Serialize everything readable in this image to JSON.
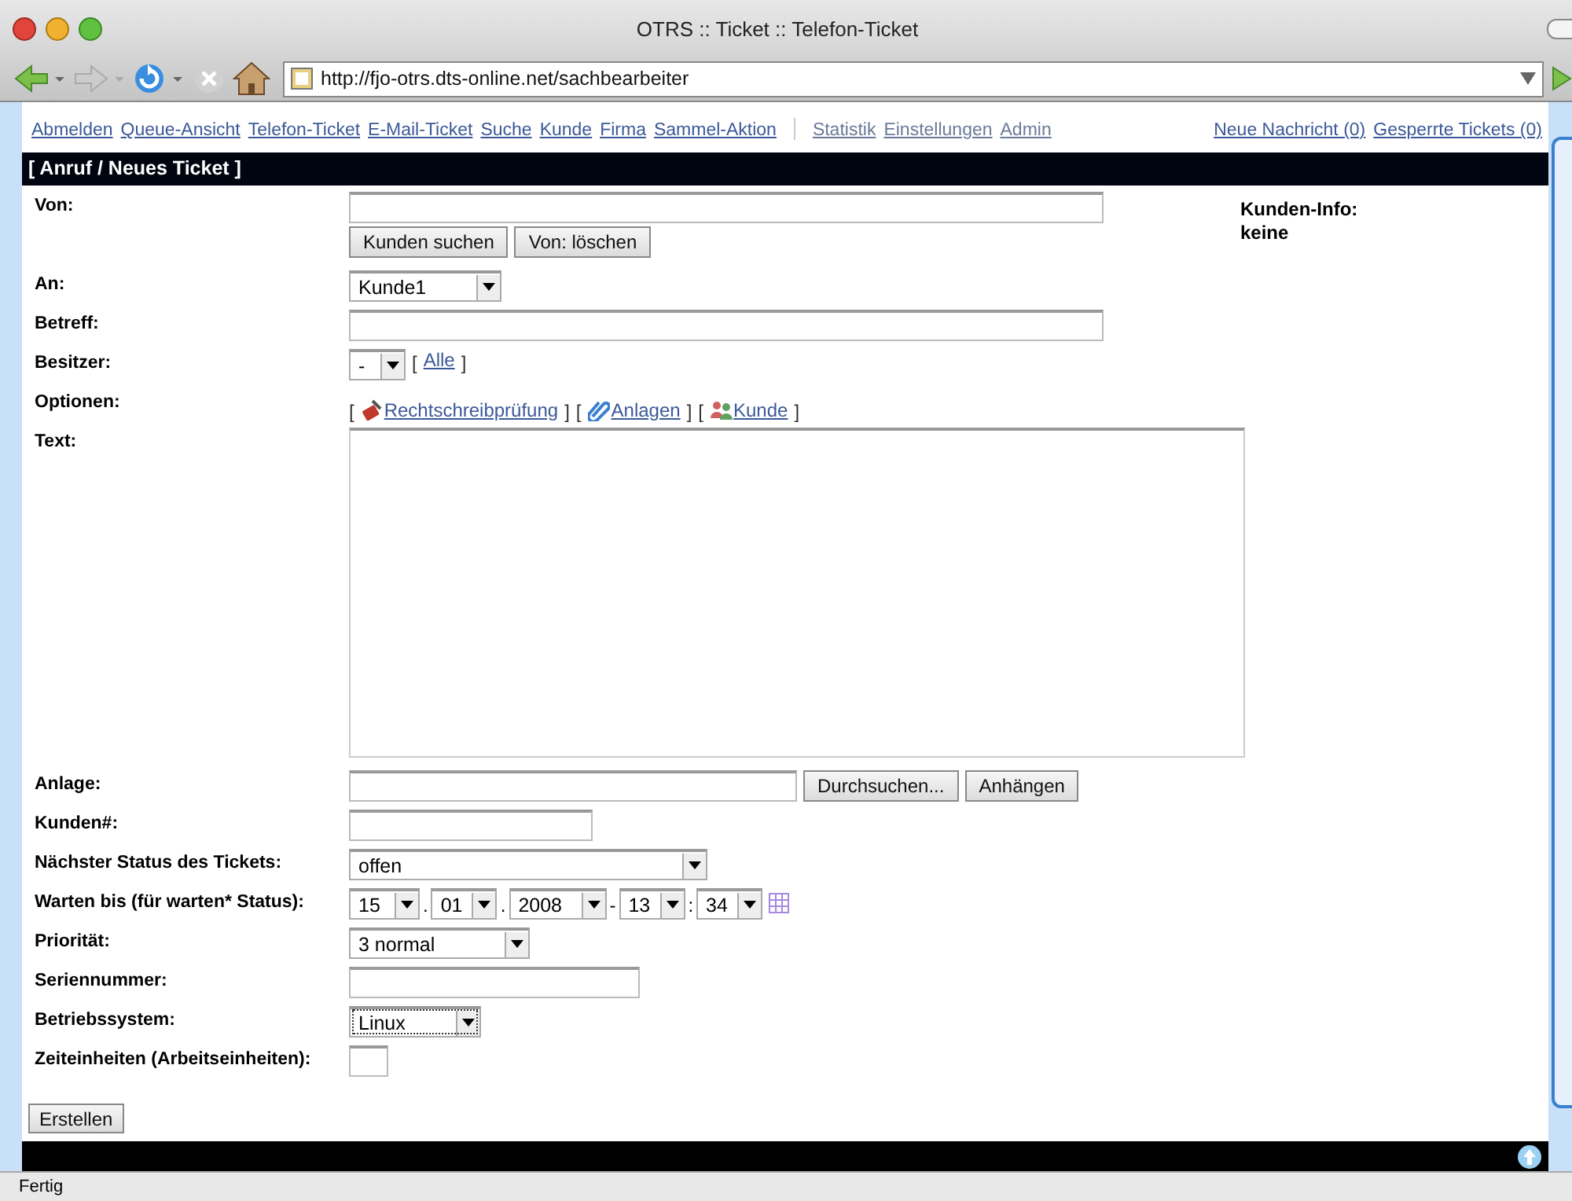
{
  "window": {
    "title": "OTRS :: Ticket :: Telefon-Ticket"
  },
  "toolbar": {
    "url": "http://fjo-otrs.dts-online.net/sachbearbeiter"
  },
  "nav": {
    "links": [
      {
        "label": "Abmelden",
        "kind": "main"
      },
      {
        "label": "Queue-Ansicht",
        "kind": "main"
      },
      {
        "label": "Telefon-Ticket",
        "kind": "main"
      },
      {
        "label": "E-Mail-Ticket",
        "kind": "main"
      },
      {
        "label": "Suche",
        "kind": "main"
      },
      {
        "label": "Kunde",
        "kind": "main"
      },
      {
        "label": "Firma",
        "kind": "main"
      },
      {
        "label": "Sammel-Aktion",
        "kind": "main"
      },
      {
        "label": "Statistik",
        "kind": "admin"
      },
      {
        "label": "Einstellungen",
        "kind": "admin"
      },
      {
        "label": "Admin",
        "kind": "admin"
      },
      {
        "label": "Neue Nachricht (0)",
        "kind": "right"
      },
      {
        "label": "Gesperrte Tickets (0)",
        "kind": "right"
      }
    ]
  },
  "form": {
    "heading": "[ Anruf / Neues Ticket ]",
    "fields": [
      {
        "label": "Von:",
        "kind": "sender",
        "buttons": [
          "Kunden suchen",
          "Von: löschen"
        ]
      },
      {
        "label": "An:",
        "kind": "select",
        "value": "Kunde1"
      },
      {
        "label": "Betreff:",
        "kind": "text"
      },
      {
        "label": "Besitzer:",
        "kind": "owner",
        "value": "-",
        "link": {
          "open": "[",
          "label": "Alle",
          "close": "]"
        }
      },
      {
        "label": "Optionen:",
        "kind": "options",
        "links": [
          {
            "open": "[",
            "label": "Rechtschreibprüfung",
            "close": "]",
            "kind": "spellcheck"
          },
          {
            "open": "[",
            "label": "Anlagen",
            "close": "]",
            "kind": "attachment"
          },
          {
            "open": "[",
            "label": "Kunde",
            "close": "]",
            "kind": "customer"
          }
        ]
      },
      {
        "label": "Text:",
        "kind": "textarea"
      },
      {
        "label": "Anlage:",
        "kind": "file",
        "buttons": [
          "Durchsuchen...",
          "Anhängen"
        ]
      },
      {
        "label": "Kunden#:",
        "kind": "text"
      },
      {
        "label": "Nächster Status des Tickets:",
        "kind": "select",
        "value": "offen"
      },
      {
        "label": "Warten bis (für warten* Status):",
        "kind": "datetime",
        "parts": [
          {
            "value": "15"
          },
          {
            "sep": ".",
            "value": "01"
          },
          {
            "sep": ".",
            "value": "2008"
          },
          {
            "sep": "-",
            "value": "13"
          },
          {
            "sep": ":",
            "value": "34"
          }
        ]
      },
      {
        "label": "Priorität:",
        "kind": "select",
        "value": "3 normal"
      },
      {
        "label": "Seriennummer:",
        "kind": "text"
      },
      {
        "label": "Betriebssystem:",
        "kind": "select",
        "value": "Linux",
        "focused": true
      },
      {
        "label": "Zeiteinheiten (Arbeitseinheiten):",
        "kind": "text"
      }
    ],
    "submit": "Erstellen"
  },
  "customer_info": {
    "label": "Kunden-Info:",
    "value": "keine"
  },
  "status_bar": {
    "text": "Fertig"
  }
}
